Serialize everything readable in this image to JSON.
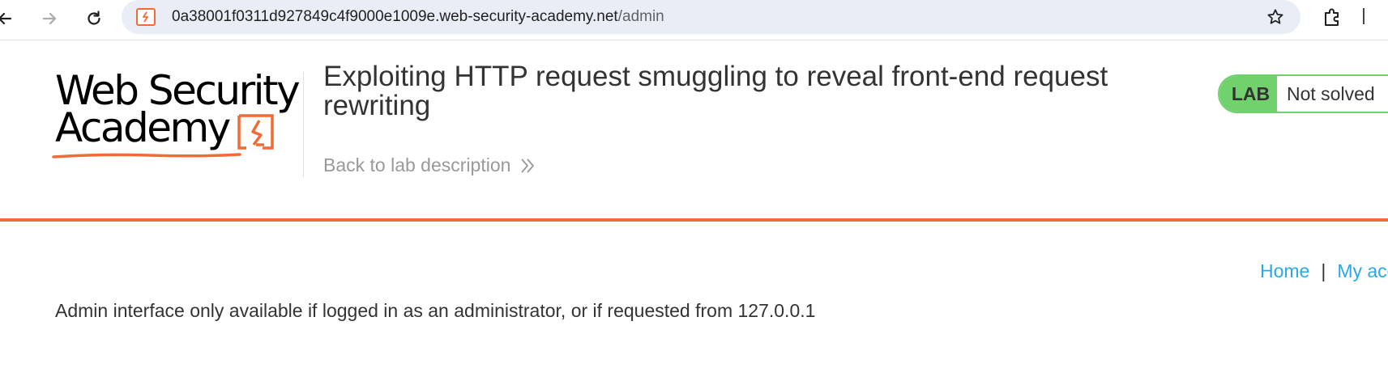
{
  "browser": {
    "url_host": "0a38001f0311d927849c4f9000e1009e.web-security-academy.net",
    "url_path": "/admin"
  },
  "logo": {
    "line1": "Web Security",
    "line2": "Academy"
  },
  "lab": {
    "title": "Exploiting HTTP request smuggling to reveal front-end request rewriting",
    "back_link": "Back to lab description",
    "badge": "LAB",
    "status": "Not solved"
  },
  "nav": {
    "home": "Home",
    "separator": "|",
    "my_account": "My account"
  },
  "content": {
    "message": "Admin interface only available if logged in as an administrator, or if requested from 127.0.0.1"
  },
  "colors": {
    "accent_orange": "#f06b36",
    "lab_green": "#70d16d",
    "link_blue": "#29a9e5"
  }
}
